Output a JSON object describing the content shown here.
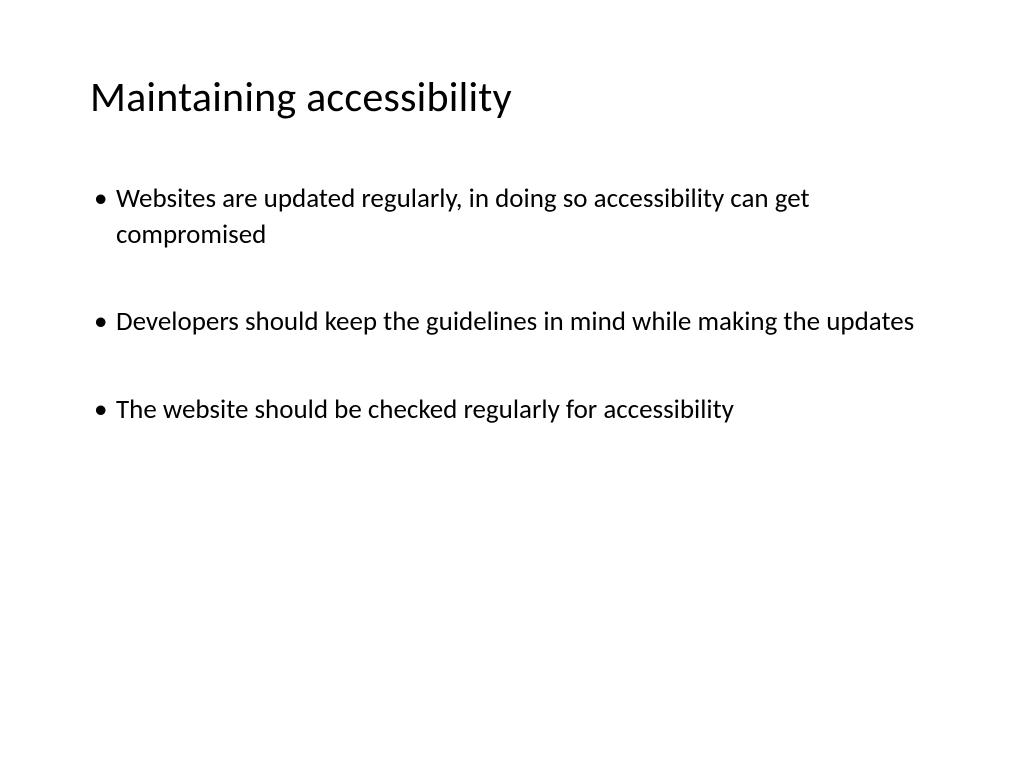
{
  "slide": {
    "title": "Maintaining accessibility",
    "bullets": [
      "Websites are updated regularly, in doing so accessibility can get compromised",
      "Developers should keep the guidelines in mind while making the updates",
      "The website should be checked regularly for accessibility"
    ]
  }
}
